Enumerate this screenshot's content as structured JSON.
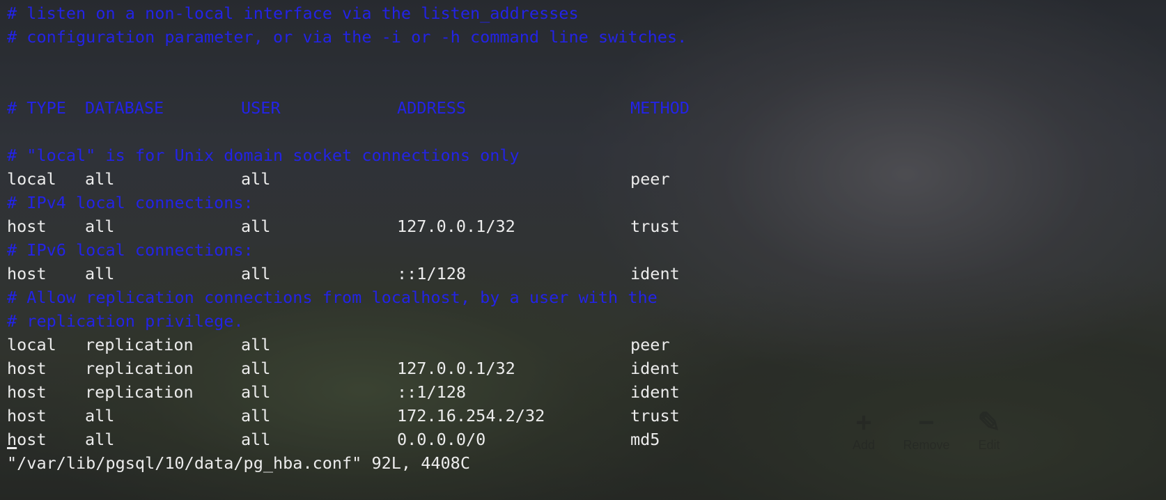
{
  "terminal": {
    "comment_lines_top": [
      "# listen on a non-local interface via the listen_addresses",
      "# configuration parameter, or via the -i or -h command line switches."
    ],
    "header": {
      "type": "# TYPE",
      "database": "DATABASE",
      "user": "USER",
      "address": "ADDRESS",
      "method": "METHOD"
    },
    "comments": {
      "local_socket": "# \"local\" is for Unix domain socket connections only",
      "ipv4": "# IPv4 local connections:",
      "ipv6": "# IPv6 local connections:",
      "replication_1": "# Allow replication connections from localhost, by a user with the",
      "replication_2": "# replication privilege."
    },
    "rows": [
      {
        "type": "local",
        "database": "all",
        "user": "all",
        "address": "",
        "method": "peer"
      },
      {
        "type": "host",
        "database": "all",
        "user": "all",
        "address": "127.0.0.1/32",
        "method": "trust"
      },
      {
        "type": "host",
        "database": "all",
        "user": "all",
        "address": "::1/128",
        "method": "ident"
      },
      {
        "type": "local",
        "database": "replication",
        "user": "all",
        "address": "",
        "method": "peer"
      },
      {
        "type": "host",
        "database": "replication",
        "user": "all",
        "address": "127.0.0.1/32",
        "method": "ident"
      },
      {
        "type": "host",
        "database": "replication",
        "user": "all",
        "address": "::1/128",
        "method": "ident"
      },
      {
        "type": "host",
        "database": "all",
        "user": "all",
        "address": "172.16.254.2/32",
        "method": "trust"
      },
      {
        "type": "host",
        "database": "all",
        "user": "all",
        "address": "0.0.0.0/0",
        "method": "md5"
      }
    ],
    "last_row_cursor_char": "h",
    "last_row_type_rest": "ost",
    "status_line": "\"/var/lib/pgsql/10/data/pg_hba.conf\" 92L, 4408C"
  },
  "background_window": {
    "add_label": "Add",
    "remove_label": "Remove",
    "edit_label": "Edit"
  },
  "colors": {
    "comment": "#2323e6",
    "text": "#ececec"
  }
}
